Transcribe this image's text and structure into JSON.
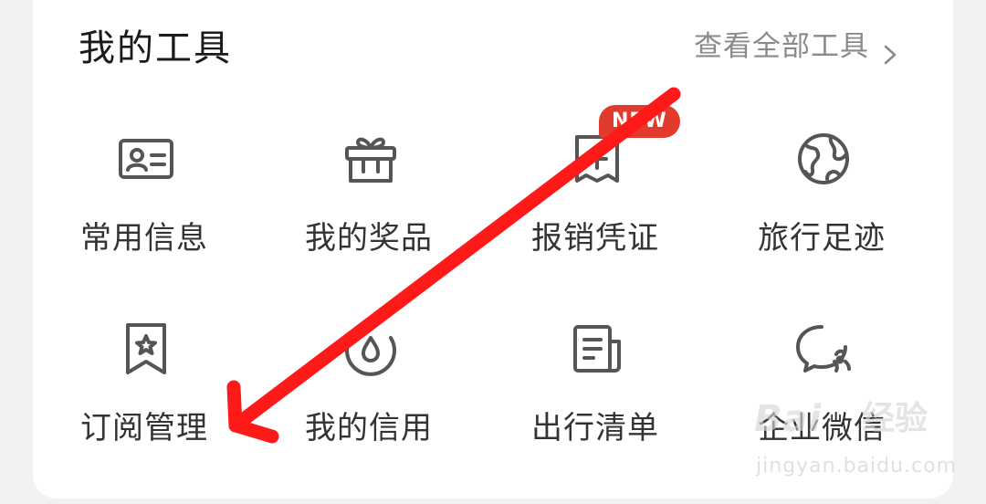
{
  "section": {
    "title": "我的工具",
    "view_all_label": "查看全部工具"
  },
  "tools": [
    {
      "label": "常用信息",
      "icon": "id-card-icon"
    },
    {
      "label": "我的奖品",
      "icon": "gift-icon"
    },
    {
      "label": "报销凭证",
      "icon": "receipt-icon",
      "badge": "NEW"
    },
    {
      "label": "旅行足迹",
      "icon": "globe-icon"
    },
    {
      "label": "订阅管理",
      "icon": "bookmark-star-icon"
    },
    {
      "label": "我的信用",
      "icon": "credit-drop-icon"
    },
    {
      "label": "出行清单",
      "icon": "checklist-doc-icon"
    },
    {
      "label": "企业微信",
      "icon": "wecom-chat-icon"
    }
  ],
  "watermark": {
    "logo": "Bai",
    "logo_cn": "经验",
    "url": "jingyan.baidu.com"
  },
  "colors": {
    "annotation_arrow": "#ff1a1a",
    "badge": "#e23a2c",
    "icon_stroke": "#555555"
  }
}
